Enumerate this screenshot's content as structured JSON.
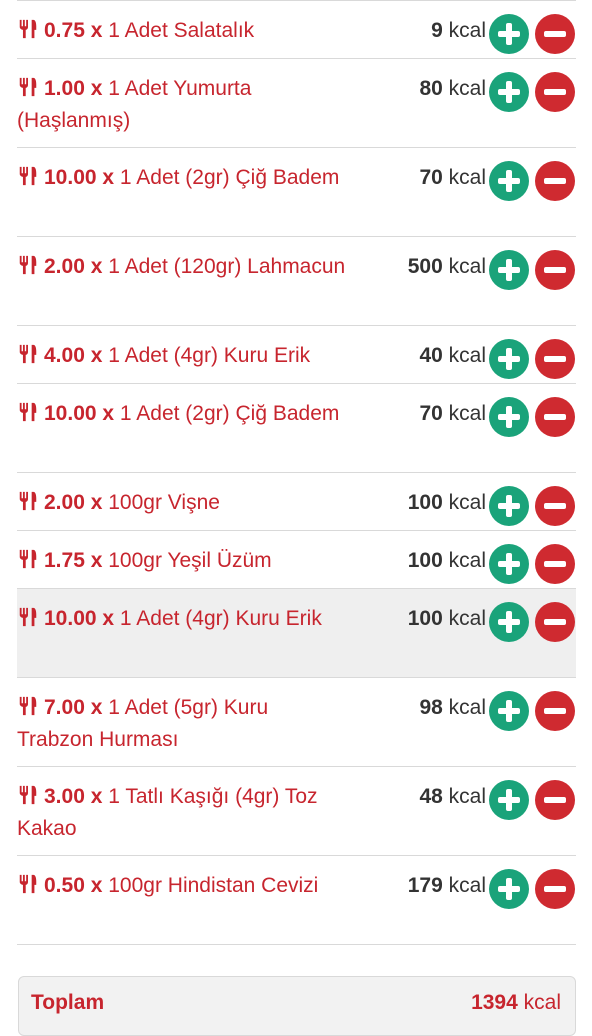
{
  "colors": {
    "accent": "#c7252e",
    "add": "#1aa37a",
    "remove": "#cf2a30"
  },
  "icons": {
    "meal": "fork-knife-icon",
    "add": "plus-circle-icon",
    "remove": "minus-circle-icon"
  },
  "items": [
    {
      "qty": "0.75 x",
      "name": "1 Adet Salatalık",
      "kcal_value": "9",
      "kcal_unit": "kcal"
    },
    {
      "qty": "1.00 x",
      "name": "1 Adet Yumurta (Haşlanmış)",
      "kcal_value": "80",
      "kcal_unit": "kcal"
    },
    {
      "qty": "10.00 x",
      "name": "1 Adet (2gr) Çiğ Badem",
      "kcal_value": "70",
      "kcal_unit": "kcal"
    },
    {
      "qty": "2.00 x",
      "name": "1 Adet (120gr) Lahmacun",
      "kcal_value": "500",
      "kcal_unit": "kcal"
    },
    {
      "qty": "4.00 x",
      "name": "1 Adet (4gr) Kuru Erik",
      "kcal_value": "40",
      "kcal_unit": "kcal"
    },
    {
      "qty": "10.00 x",
      "name": "1 Adet (2gr) Çiğ Badem",
      "kcal_value": "70",
      "kcal_unit": "kcal"
    },
    {
      "qty": "2.00 x",
      "name": "100gr Vişne",
      "kcal_value": "100",
      "kcal_unit": "kcal"
    },
    {
      "qty": "1.75 x",
      "name": "100gr Yeşil Üzüm",
      "kcal_value": "100",
      "kcal_unit": "kcal"
    },
    {
      "qty": "10.00 x",
      "name": "1 Adet (4gr) Kuru Erik",
      "kcal_value": "100",
      "kcal_unit": "kcal"
    },
    {
      "qty": "7.00 x",
      "name": "1 Adet (5gr) Kuru Trabzon Hurması",
      "kcal_value": "98",
      "kcal_unit": "kcal"
    },
    {
      "qty": "3.00 x",
      "name": "1 Tatlı Kaşığı (4gr) Toz Kakao",
      "kcal_value": "48",
      "kcal_unit": "kcal"
    },
    {
      "qty": "0.50 x",
      "name": "100gr Hindistan Cevizi",
      "kcal_value": "179",
      "kcal_unit": "kcal"
    }
  ],
  "total": {
    "label": "Toplam",
    "value": "1394",
    "unit": "kcal"
  }
}
